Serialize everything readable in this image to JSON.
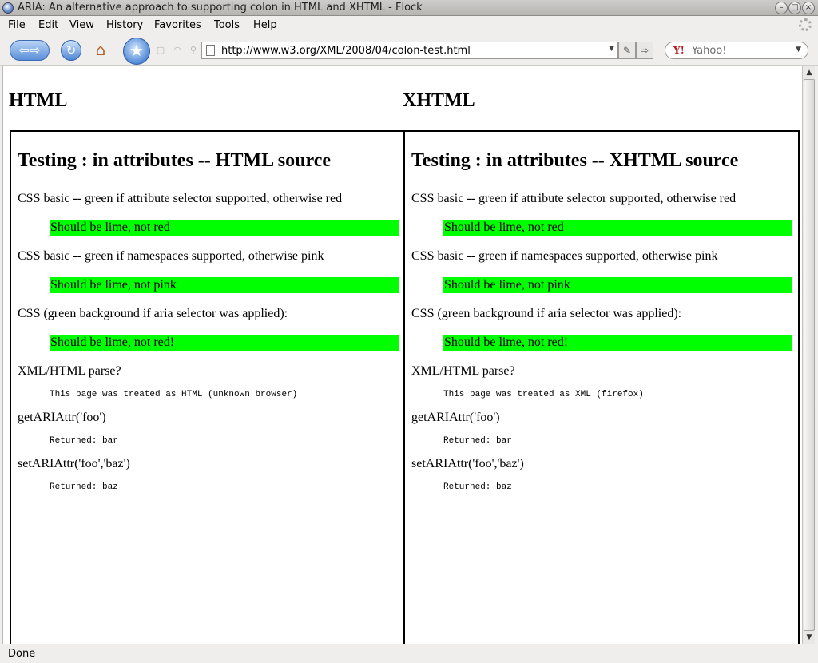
{
  "window": {
    "title": "ARIA: An alternative approach to supporting colon in HTML and XHTML - Flock"
  },
  "menu": {
    "items": [
      "File",
      "Edit",
      "View",
      "History",
      "Favorites",
      "Tools",
      "Help"
    ]
  },
  "toolbar": {
    "url": "http://www.w3.org/XML/2008/04/colon-test.html",
    "search_placeholder": "Yahoo!"
  },
  "page": {
    "col_headings": [
      "HTML",
      "XHTML"
    ],
    "frames": [
      {
        "heading": "Testing : in attributes -- HTML source",
        "css_basic_label": "CSS basic -- green if attribute selector supported, otherwise red",
        "css_basic_result": "Should be lime, not red",
        "css_ns_label": "CSS basic -- green if namespaces supported, otherwise pink",
        "css_ns_result": "Should be lime, not pink",
        "css_aria_label": "CSS (green background if aria selector was applied):",
        "css_aria_result": "Should be lime, not red!",
        "parse_label": "XML/HTML parse?",
        "parse_result": "This page was treated as HTML (unknown browser)",
        "get_label": "getARIAttr('foo')",
        "get_result": "Returned: bar",
        "set_label": "setARIAttr('foo','baz')",
        "set_result": "Returned: baz"
      },
      {
        "heading": "Testing : in attributes -- XHTML source",
        "css_basic_label": "CSS basic -- green if attribute selector supported, otherwise red",
        "css_basic_result": "Should be lime, not red",
        "css_ns_label": "CSS basic -- green if namespaces supported, otherwise pink",
        "css_ns_result": "Should be lime, not pink",
        "css_aria_label": "CSS (green background if aria selector was applied):",
        "css_aria_result": "Should be lime, not red!",
        "parse_label": "XML/HTML parse?",
        "parse_result": "This page was treated as XML (firefox)",
        "get_label": "getARIAttr('foo')",
        "get_result": "Returned: bar",
        "set_label": "setARIAttr('foo','baz')",
        "set_result": "Returned: baz"
      }
    ]
  },
  "status": {
    "text": "Done"
  },
  "colors": {
    "lime": "#00ff00"
  }
}
